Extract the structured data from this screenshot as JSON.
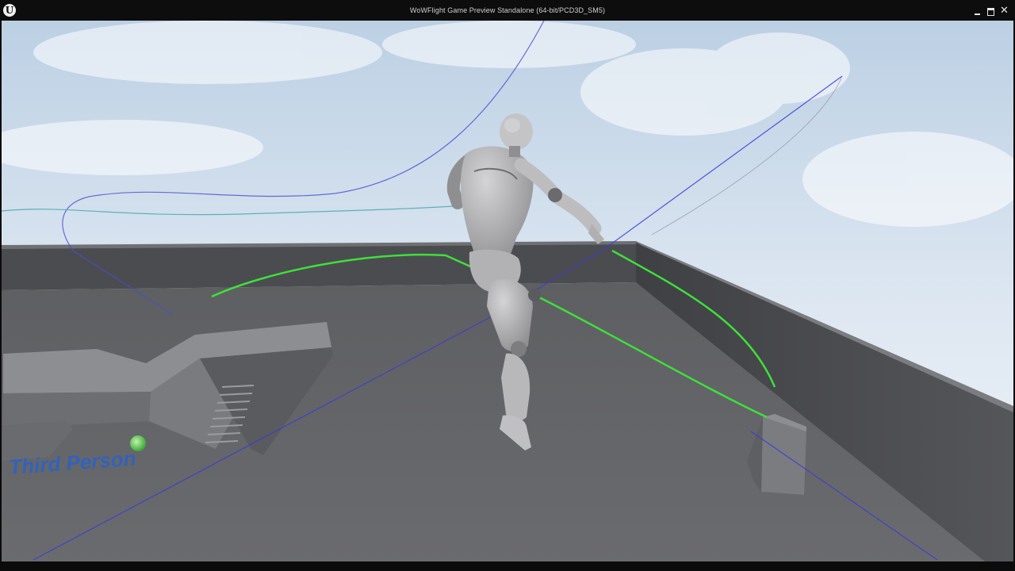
{
  "window": {
    "title": "WoWFlight Game Preview Standalone (64-bit/PCD3D_SM5)",
    "logo_glyph": "U",
    "close_glyph": "✕",
    "controls": [
      "minimize",
      "maximize",
      "close"
    ]
  },
  "scene": {
    "floor_text": "Third Person",
    "colors": {
      "sky_top": "#bcd0e4",
      "sky_bottom": "#eef3f9",
      "floor": "#5c5d60",
      "wall": "#4a4b4f",
      "ledge_top": "#707174",
      "character": "#b9b9bb",
      "green_trail": "#3ee03a",
      "blue_trail": "#3b3bd8",
      "cyan_trail": "#4aa7b0",
      "floor_text": "#2a62c9"
    },
    "icons": [
      "unreal-logo-icon",
      "green-orb-icon"
    ]
  }
}
